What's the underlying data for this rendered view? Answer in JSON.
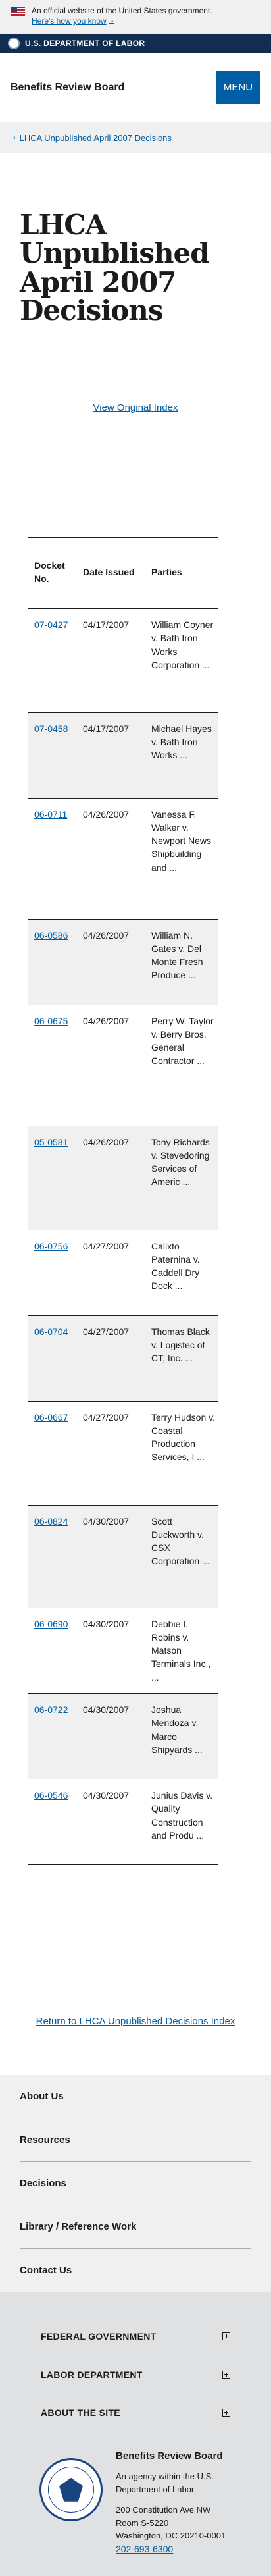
{
  "gov_banner": {
    "text": "An official website of the United States government.",
    "link": "Here's how you know"
  },
  "dol_strip": {
    "label": "U.S. DEPARTMENT OF LABOR"
  },
  "header": {
    "site_title": "Benefits Review Board",
    "menu_label": "MENU"
  },
  "breadcrumb": {
    "label": "LHCA Unpublished April 2007 Decisions"
  },
  "page": {
    "title": "LHCA Unpublished April 2007 Decisions",
    "view_original": "View Original Index",
    "return_link": "Return to LHCA Unpublished Decisions Index"
  },
  "table": {
    "headers": [
      "Docket No.",
      "Date Issued",
      "Parties"
    ],
    "rows": [
      {
        "docket": "07-0427",
        "date": "04/17/2007",
        "parties": "William Coyner v. Bath Iron Works Corporation ..."
      },
      {
        "docket": "07-0458",
        "date": "04/17/2007",
        "parties": "Michael Hayes v. Bath Iron Works ..."
      },
      {
        "docket": "06-0711",
        "date": "04/26/2007",
        "parties": "Vanessa F. Walker v. Newport News Shipbuilding and ..."
      },
      {
        "docket": "06-0586",
        "date": "04/26/2007",
        "parties": "William N. Gates v. Del Monte Fresh Produce ..."
      },
      {
        "docket": "06-0675",
        "date": "04/26/2007",
        "parties": "Perry W. Taylor v. Berry Bros. General Contractor ..."
      },
      {
        "docket": "05-0581",
        "date": "04/26/2007",
        "parties": "Tony Richards v. Stevedoring Services of Americ ..."
      },
      {
        "docket": "06-0756",
        "date": "04/27/2007",
        "parties": "Calixto Paternina v. Caddell Dry Dock ..."
      },
      {
        "docket": "06-0704",
        "date": "04/27/2007",
        "parties": "Thomas Black v. Logistec of CT, Inc. ..."
      },
      {
        "docket": "06-0667",
        "date": "04/27/2007",
        "parties": "Terry Hudson v. Coastal Production Services, I ..."
      },
      {
        "docket": "06-0824",
        "date": "04/30/2007",
        "parties": "Scott Duckworth v. CSX Corporation ..."
      },
      {
        "docket": "06-0690",
        "date": "04/30/2007",
        "parties": "Debbie I. Robins v. Matson Terminals Inc., ..."
      },
      {
        "docket": "06-0722",
        "date": "04/30/2007",
        "parties": "Joshua Mendoza v. Marco Shipyards ..."
      },
      {
        "docket": "06-0546",
        "date": "04/30/2007",
        "parties": "Junius Davis v. Quality Construction and Produ ..."
      }
    ]
  },
  "footer_nav": {
    "items": [
      "About Us",
      "Resources",
      "Decisions",
      "Library / Reference Work",
      "Contact Us"
    ]
  },
  "footer_accordions": {
    "items": [
      "FEDERAL GOVERNMENT",
      "LABOR DEPARTMENT",
      "ABOUT THE SITE"
    ]
  },
  "contact": {
    "title": "Benefits Review Board",
    "agency": "An agency within the U.S. Department of Labor",
    "address_1": "200 Constitution Ave NW",
    "address_2": "Room S-5220",
    "address_3": "Washington, DC 20210-0001",
    "phone": "202-693-6300"
  },
  "colors": {
    "link": "#005ea2",
    "dol_navy": "#112e51",
    "menu_button": "#005ea2",
    "stripe": "#f0f0f0"
  }
}
